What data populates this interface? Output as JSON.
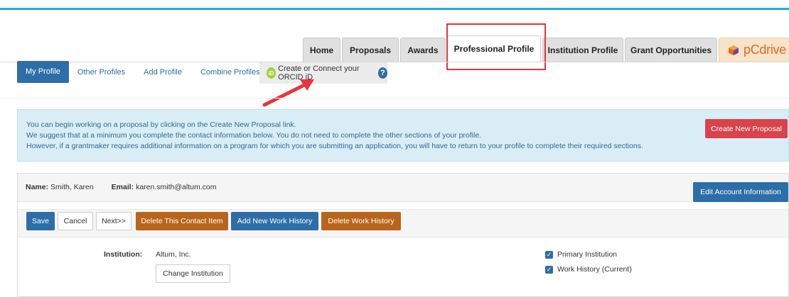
{
  "nav": {
    "tabs": [
      "Home",
      "Proposals",
      "Awards",
      "Professional Profile",
      "Institution Profile",
      "Grant Opportunities"
    ],
    "pcdrive_label": "pCdrive"
  },
  "subnav": {
    "my_profile": "My Profile",
    "other_profiles": "Other Profiles",
    "add_profile": "Add Profile",
    "combine_profiles": "Combine Profiles",
    "orcid_badge": "iD",
    "orcid_link": "Create or Connect your ORCID iD",
    "help": "?"
  },
  "banner": {
    "line1": "You can begin working on a proposal by clicking on the Create New Proposal link.",
    "line2": "We suggest that at a minimum you complete the contact information below. You do not need to complete the other sections of your profile.",
    "line3": "However, if a grantmaker requires additional information on a program for which you are submitting an application, you will have to return to your profile to complete their required sections.",
    "create_button": "Create New Proposal"
  },
  "contact": {
    "name_label": "Name:",
    "name_value": "Smith, Karen",
    "email_label": "Email:",
    "email_value": "karen.smith@altum.com",
    "edit_button": "Edit Account Information"
  },
  "actions": {
    "save": "Save",
    "cancel": "Cancel",
    "next": "Next>>",
    "delete_contact": "Delete This Contact Item",
    "add_work": "Add New Work History",
    "delete_work": "Delete Work History"
  },
  "institution": {
    "label": "Institution:",
    "value": "Altum, Inc.",
    "change_button": "Change Institution",
    "primary_label": "Primary Institution",
    "primary_checked": true,
    "work_current_label": "Work History (Current)",
    "work_current_checked": true
  },
  "colors": {
    "accent_blue": "#2d6ea8",
    "top_bar": "#29a8e0",
    "danger_red": "#d9434a",
    "orange_brown": "#b8651b",
    "highlight_red": "#e6353b",
    "orcid_green": "#a6ce39"
  }
}
